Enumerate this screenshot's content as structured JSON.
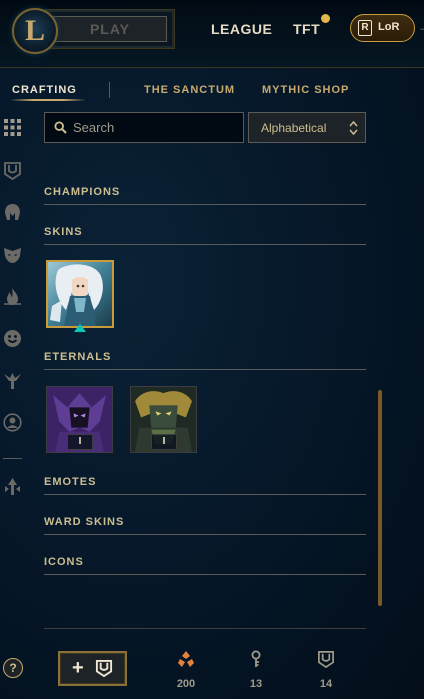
{
  "header": {
    "play_label": "PLAY",
    "nav": [
      {
        "label": "LEAGUE"
      },
      {
        "label": "TFT"
      }
    ],
    "lor_label": "LoR",
    "lor_badge": "R",
    "edge_glyph": "→"
  },
  "tabs": [
    {
      "label": "CRAFTING"
    },
    {
      "label": "THE SANCTUM"
    },
    {
      "label": "MYTHIC SHOP"
    }
  ],
  "sidebar": {
    "icons": [
      "grid-icon",
      "chest-icon",
      "helmet-icon",
      "mask-icon",
      "flame-icon",
      "emote-face-icon",
      "ward-totem-icon",
      "profile-icon",
      "crafting-arrow-icon"
    ]
  },
  "search": {
    "placeholder": "Search",
    "value": ""
  },
  "sort": {
    "selected": "Alphabetical"
  },
  "sections": [
    {
      "title": "CHAMPIONS"
    },
    {
      "title": "SKINS"
    },
    {
      "title": "ETERNALS"
    },
    {
      "title": "EMOTES"
    },
    {
      "title": "WARD SKINS"
    },
    {
      "title": "ICONS"
    }
  ],
  "eternals": [
    {
      "badge": "I"
    },
    {
      "badge": "I"
    }
  ],
  "footer": {
    "help_label": "?",
    "add_label": "+",
    "currencies": [
      {
        "name": "orange-essence-icon",
        "value": "200",
        "color": "#e3823b"
      },
      {
        "name": "key-icon",
        "value": "13",
        "color": "#a09b8c"
      },
      {
        "name": "chest-icon",
        "value": "14",
        "color": "#a09b8c"
      }
    ]
  },
  "colors": {
    "gold": "#c8aa6e",
    "accent_teal": "#0ac8b9",
    "orange": "#e3823b"
  }
}
